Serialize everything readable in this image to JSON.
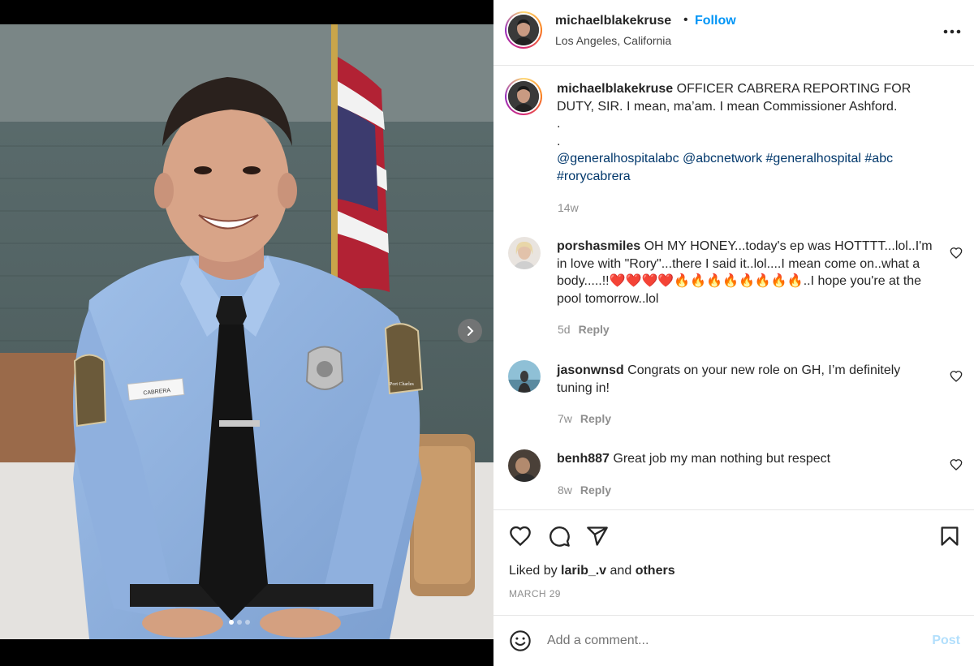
{
  "post": {
    "username": "michaelblakekruse",
    "separator": "•",
    "follow_label": "Follow",
    "location": "Los Angeles, California",
    "more_label": "•••",
    "caption": {
      "username": "michaelblakekruse",
      "text": "OFFICER CABRERA REPORTING FOR DUTY, SIR. I mean, ma’am. I mean Commissioner Ashford.",
      "dot1": ".",
      "dot2": ".",
      "mentions": [
        "@generalhospitalabc",
        "@abcnetwork",
        "#generalhospital",
        "#abc",
        "#rorycabrera"
      ],
      "age": "14w"
    },
    "comments": [
      {
        "username": "porshasmiles",
        "text": "OH MY HONEY...today's ep was HOTTTT...lol..I'm in love with \"Rory\"...there I said it..lol....I mean come on..what a body.....!!❤️❤️❤️❤️🔥🔥🔥🔥🔥🔥🔥🔥..I hope you're at the pool tomorrow..lol",
        "age": "5d",
        "reply_label": "Reply"
      },
      {
        "username": "jasonwnsd",
        "text": "Congrats on your new role on GH, I’m definitely tuning in!",
        "age": "7w",
        "reply_label": "Reply"
      },
      {
        "username": "benh887",
        "text": "Great job my man nothing but respect",
        "age": "8w",
        "reply_label": "Reply"
      }
    ],
    "liked_by_prefix": "Liked by",
    "liked_by_user": "larib_.v",
    "liked_by_and": "and",
    "liked_by_others": "others",
    "date": "MARCH 29",
    "add_comment_placeholder": "Add a comment...",
    "post_label": "Post"
  },
  "photo": {
    "name_tag": "CABRERA",
    "patch_text": "Port Charles"
  },
  "colors": {
    "follow": "#0095f6",
    "mention": "#00376b",
    "muted": "#8e8e8e",
    "post_disabled": "#b2dffc"
  },
  "icons": [
    "chevron-right-icon",
    "more-icon",
    "heart-icon",
    "comment-icon",
    "share-icon",
    "bookmark-icon",
    "emoji-icon"
  ]
}
